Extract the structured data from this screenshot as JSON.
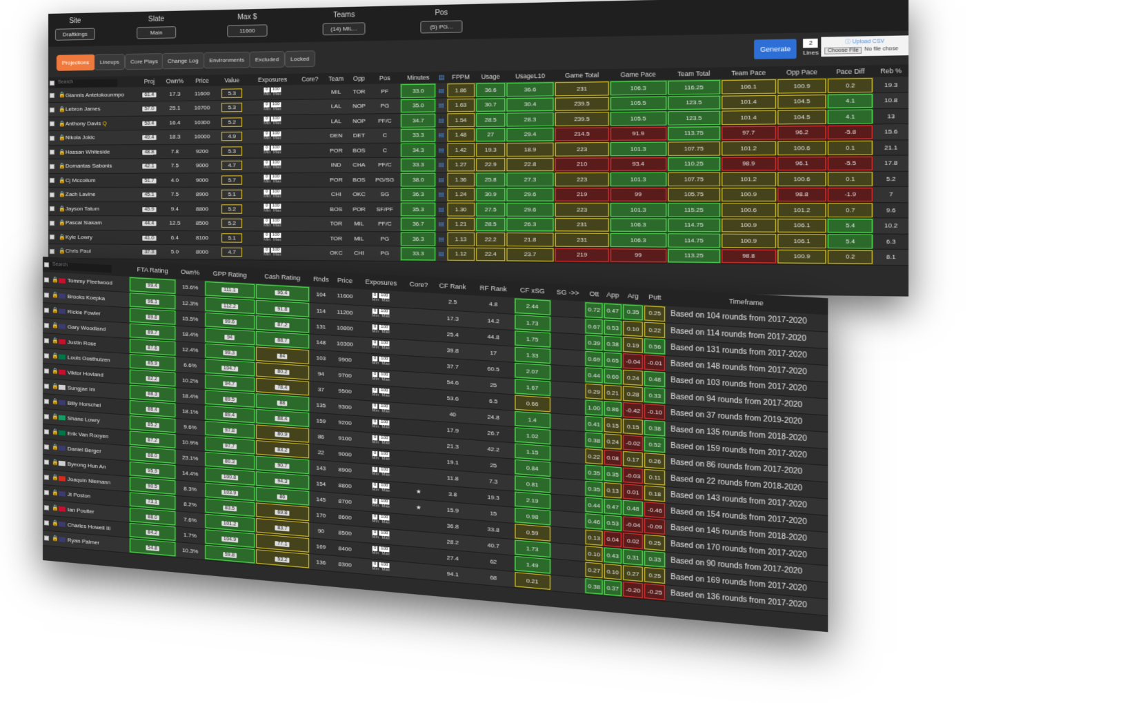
{
  "toolbar": {
    "site_label": "Site",
    "site_value": "Draftkings",
    "slate_label": "Slate",
    "slate_value": "Main",
    "max_label": "Max $",
    "max_value": "11600",
    "teams_label": "Teams",
    "teams_value": "(14) MIL...",
    "pos_label": "Pos",
    "pos_value": "(5) PG..."
  },
  "nav": [
    "Projections",
    "Lineups",
    "Core Plays",
    "Change Log",
    "Environments",
    "Excluded",
    "Locked"
  ],
  "generate": {
    "label": "Generate",
    "lines_value": "2",
    "lines_label": "Lines"
  },
  "upload": {
    "title": "Upload CSV",
    "choose": "Choose File",
    "nofile": "No file chose"
  },
  "nba": {
    "search_placeholder": "Search",
    "headers": [
      "Proj",
      "Own%",
      "Price",
      "Value",
      "Exposures",
      "Core?",
      "Team",
      "Opp",
      "Pos",
      "Minutes",
      "FPPM",
      "Usage",
      "UsageL10",
      "Game Total",
      "Game Pace",
      "Team Total",
      "Team Pace",
      "Opp Pace",
      "Pace Diff",
      "Reb %"
    ],
    "exp_min": "0",
    "exp_max": "100",
    "exp_min_lbl": "Min",
    "exp_max_lbl": "Max",
    "rows": [
      [
        "Giannis Antetokounmpo",
        "61.4",
        "17.3",
        "11600",
        "5.3",
        "MIL",
        "TOR",
        "PF",
        "33.0",
        "1.86",
        "36.6",
        "36.6",
        "231",
        "106.3",
        "116.25",
        "106.1",
        "100.9",
        "0.2",
        "19.3"
      ],
      [
        "Lebron James",
        "57.0",
        "25.1",
        "10700",
        "5.3",
        "LAL",
        "NOP",
        "PG",
        "35.0",
        "1.63",
        "30.7",
        "30.4",
        "239.5",
        "105.5",
        "123.5",
        "101.4",
        "104.5",
        "4.1",
        "10.8"
      ],
      [
        "Anthony Davis",
        "53.4",
        "16.4",
        "10300",
        "5.2",
        "LAL",
        "NOP",
        "PF/C",
        "34.7",
        "1.54",
        "28.5",
        "28.3",
        "239.5",
        "105.5",
        "123.5",
        "101.4",
        "104.5",
        "4.1",
        "13"
      ],
      [
        "Nikola Jokic",
        "49.4",
        "18.3",
        "10000",
        "4.9",
        "DEN",
        "DET",
        "C",
        "33.3",
        "1.48",
        "27",
        "29.4",
        "214.5",
        "91.9",
        "113.75",
        "97.7",
        "96.2",
        "-5.8",
        "15.6"
      ],
      [
        "Hassan Whiteside",
        "48.8",
        "7.8",
        "9200",
        "5.3",
        "POR",
        "BOS",
        "C",
        "34.3",
        "1.42",
        "19.3",
        "18.9",
        "223",
        "101.3",
        "107.75",
        "101.2",
        "100.6",
        "0.1",
        "21.1"
      ],
      [
        "Domantas Sabonis",
        "42.1",
        "7.5",
        "9000",
        "4.7",
        "IND",
        "CHA",
        "PF/C",
        "33.3",
        "1.27",
        "22.9",
        "22.8",
        "210",
        "93.4",
        "110.25",
        "98.9",
        "96.1",
        "-5.5",
        "17.8"
      ],
      [
        "Cj Mccollum",
        "51.7",
        "4.0",
        "9000",
        "5.7",
        "POR",
        "BOS",
        "PG/SG",
        "38.0",
        "1.36",
        "25.8",
        "27.3",
        "223",
        "101.3",
        "107.75",
        "101.2",
        "100.6",
        "0.1",
        "5.2"
      ],
      [
        "Zach Lavine",
        "45.1",
        "7.5",
        "8900",
        "5.1",
        "CHI",
        "OKC",
        "SG",
        "36.3",
        "1.24",
        "30.9",
        "29.6",
        "219",
        "99",
        "105.75",
        "100.9",
        "98.8",
        "-1.9",
        "7"
      ],
      [
        "Jayson Tatum",
        "45.9",
        "9.4",
        "8800",
        "5.2",
        "BOS",
        "POR",
        "SF/PF",
        "35.3",
        "1.30",
        "27.5",
        "29.6",
        "223",
        "101.3",
        "115.25",
        "100.6",
        "101.2",
        "0.7",
        "9.6"
      ],
      [
        "Pascal Siakam",
        "44.4",
        "12.5",
        "8500",
        "5.2",
        "TOR",
        "MIL",
        "PF/C",
        "36.7",
        "1.21",
        "28.5",
        "26.3",
        "231",
        "106.3",
        "114.75",
        "100.9",
        "106.1",
        "5.4",
        "10.2"
      ],
      [
        "Kyle Lowry",
        "41.0",
        "6.4",
        "8100",
        "5.1",
        "TOR",
        "MIL",
        "PG",
        "36.3",
        "1.13",
        "22.2",
        "21.8",
        "231",
        "106.3",
        "114.75",
        "100.9",
        "106.1",
        "5.4",
        "6.3"
      ],
      [
        "Chris Paul",
        "37.3",
        "5.0",
        "8000",
        "4.7",
        "OKC",
        "CHI",
        "PG",
        "33.3",
        "1.12",
        "22.4",
        "23.7",
        "219",
        "99",
        "113.25",
        "98.8",
        "100.9",
        "0.2",
        "8.1"
      ]
    ],
    "questionable_mark": "Q"
  },
  "golf": {
    "search_placeholder": "Search",
    "headers": [
      "FTA Rating",
      "Own%",
      "GPP Rating",
      "Cash Rating",
      "Rnds",
      "Price",
      "Exposures",
      "Core?",
      "CF Rank",
      "RF Rank",
      "CF xSG",
      "SG ->>",
      "Ott",
      "App",
      "Arg",
      "Putt",
      "Timeframe"
    ],
    "rows": [
      [
        "Tommy Fleetwood",
        "99.4",
        "15.6%",
        "111.1",
        "96.4",
        "104",
        "11600",
        "",
        "2.5",
        "4.8",
        "2.44",
        "0.72",
        "0.47",
        "0.35",
        "0.25",
        "Based on 104 rounds from 2017-2020"
      ],
      [
        "Brooks Koepka",
        "96.1",
        "12.3%",
        "112.2",
        "91.8",
        "114",
        "11200",
        "",
        "17.3",
        "14.2",
        "1.73",
        "0.67",
        "0.53",
        "0.10",
        "0.22",
        "Based on 114 rounds from 2017-2020"
      ],
      [
        "Rickie Fowler",
        "89.8",
        "15.5%",
        "99.6",
        "87.2",
        "131",
        "10800",
        "",
        "25.4",
        "44.8",
        "1.75",
        "0.39",
        "0.38",
        "0.19",
        "0.56",
        "Based on 131 rounds from 2017-2020"
      ],
      [
        "Gary Woodland",
        "89.7",
        "18.4%",
        "94",
        "88.7",
        "148",
        "10300",
        "",
        "39.8",
        "17",
        "1.33",
        "0.69",
        "0.65",
        "-0.04",
        "-0.01",
        "Based on 148 rounds from 2017-2020"
      ],
      [
        "Justin Rose",
        "87.6",
        "12.4%",
        "99.3",
        "84",
        "103",
        "9900",
        "",
        "37.7",
        "60.5",
        "2.07",
        "0.44",
        "0.60",
        "0.24",
        "0.48",
        "Based on 103 rounds from 2017-2020"
      ],
      [
        "Louis Oosthuizen",
        "85.9",
        "6.6%",
        "104.7",
        "80.2",
        "94",
        "9700",
        "",
        "54.6",
        "25",
        "1.67",
        "0.29",
        "0.21",
        "0.28",
        "0.33",
        "Based on 94 rounds from 2017-2020"
      ],
      [
        "Viktor Hovland",
        "82.2",
        "10.2%",
        "94.7",
        "78.4",
        "37",
        "9500",
        "",
        "53.6",
        "6.5",
        "0.66",
        "1.00",
        "0.86",
        "-0.42",
        "-0.10",
        "Based on 37 rounds from 2019-2020"
      ],
      [
        "Sungjae Im",
        "88.3",
        "18.4%",
        "89.5",
        "88",
        "135",
        "9300",
        "",
        "40",
        "24.8",
        "1.4",
        "0.41",
        "0.15",
        "0.15",
        "0.38",
        "Based on 135 rounds from 2018-2020"
      ],
      [
        "Billy Horschel",
        "88.4",
        "18.1%",
        "89.4",
        "88.4",
        "159",
        "9200",
        "",
        "17.9",
        "26.7",
        "1.02",
        "0.38",
        "0.24",
        "-0.02",
        "0.52",
        "Based on 159 rounds from 2017-2020"
      ],
      [
        "Shane Lowry",
        "85.2",
        "9.6%",
        "97.8",
        "80.9",
        "86",
        "9100",
        "",
        "21.3",
        "42.2",
        "1.15",
        "0.22",
        "0.08",
        "0.17",
        "0.26",
        "Based on 86 rounds from 2017-2020"
      ],
      [
        "Erik Van Rooyen",
        "87.2",
        "10.9%",
        "97.7",
        "83.2",
        "22",
        "9000",
        "",
        "19.1",
        "25",
        "0.84",
        "0.35",
        "0.35",
        "-0.03",
        "0.11",
        "Based on 22 rounds from 2018-2020"
      ],
      [
        "Daniel Berger",
        "88.0",
        "23.1%",
        "80.3",
        "90.7",
        "143",
        "8900",
        "",
        "11.8",
        "7.3",
        "0.81",
        "0.35",
        "0.13",
        "0.01",
        "0.18",
        "Based on 143 rounds from 2017-2020"
      ],
      [
        "Byeong Hun An",
        "95.9",
        "14.4%",
        "100.8",
        "94.3",
        "154",
        "8800",
        "★",
        "3.8",
        "19.3",
        "2.19",
        "0.44",
        "0.47",
        "0.48",
        "-0.46",
        "Based on 154 rounds from 2017-2020"
      ],
      [
        "Joaquin Niemann",
        "90.5",
        "8.3%",
        "103.9",
        "86",
        "145",
        "8700",
        "★",
        "15.9",
        "15",
        "0.98",
        "0.46",
        "0.53",
        "-0.04",
        "-0.09",
        "Based on 145 rounds from 2018-2020"
      ],
      [
        "Jt Poston",
        "73.1",
        "8.2%",
        "83.5",
        "69.8",
        "170",
        "8600",
        "",
        "36.8",
        "33.8",
        "0.59",
        "0.13",
        "0.04",
        "0.02",
        "0.25",
        "Based on 170 rounds from 2017-2020"
      ],
      [
        "Ian Poulter",
        "88.0",
        "7.6%",
        "101.2",
        "83.7",
        "90",
        "8500",
        "",
        "28.2",
        "40.7",
        "1.73",
        "0.10",
        "0.43",
        "0.31",
        "0.33",
        "Based on 90 rounds from 2017-2020"
      ],
      [
        "Charles Howell III",
        "84.2",
        "1.7%",
        "104.9",
        "77.1",
        "169",
        "8400",
        "",
        "27.4",
        "62",
        "1.49",
        "0.27",
        "0.10",
        "0.27",
        "0.25",
        "Based on 169 rounds from 2017-2020"
      ],
      [
        "Ryan Palmer",
        "54.8",
        "10.3%",
        "59.8",
        "53.2",
        "136",
        "8300",
        "",
        "94.1",
        "68",
        "0.21",
        "0.38",
        "0.37",
        "-0.20",
        "-0.25",
        "Based on 136 rounds from 2017-2020"
      ]
    ]
  },
  "colors": {
    "accent": "#f07a3e",
    "generate": "#2d6fd6",
    "good": "#4ee04e",
    "mid": "#d6c22a",
    "bad": "#e03030"
  }
}
